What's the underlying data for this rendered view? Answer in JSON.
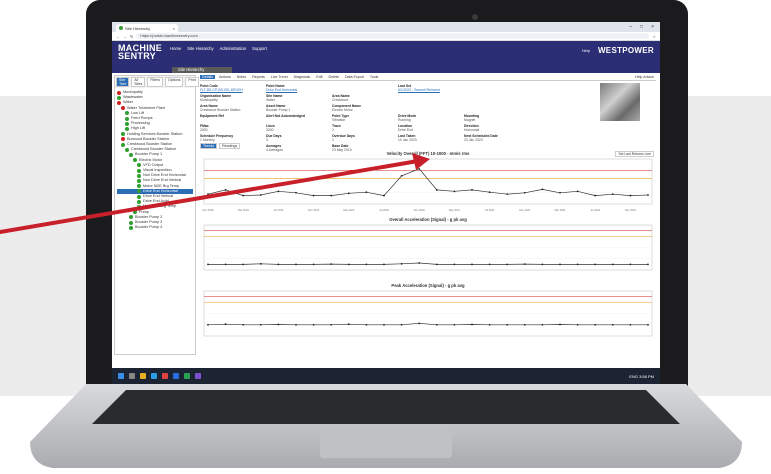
{
  "browser": {
    "tab_title": "Site Hierarchy",
    "url": "https://portal.machinesentry.com",
    "window_controls": [
      "–",
      "□",
      "×"
    ]
  },
  "app": {
    "logo_line1": "MACHINE",
    "logo_line2": "SENTRY",
    "nav": [
      "Home",
      "Site Hierarchy",
      "Administration",
      "Support"
    ],
    "help": "Help",
    "brand": "WESTPOWER",
    "page_title": "Site Hierarchy"
  },
  "sidebar": {
    "tabs": [
      "Site Tree",
      "All Sites",
      "Filters",
      "Options",
      "Print"
    ],
    "tree": [
      {
        "label": "Municipality",
        "status": "red",
        "depth": 0
      },
      {
        "label": "Wastewater",
        "status": "green",
        "depth": 0
      },
      {
        "label": "Water",
        "status": "red",
        "depth": 0
      },
      {
        "label": "Water Treatment Plant",
        "status": "red",
        "depth": 1
      },
      {
        "label": "Low Lift",
        "status": "green",
        "depth": 2
      },
      {
        "label": "Feed Pumps",
        "status": "green",
        "depth": 2
      },
      {
        "label": "Processing",
        "status": "green",
        "depth": 2
      },
      {
        "label": "High Lift",
        "status": "green",
        "depth": 2
      },
      {
        "label": "Holding Services Booster Station",
        "status": "green",
        "depth": 1
      },
      {
        "label": "Burwood Booster Station",
        "status": "red",
        "depth": 1
      },
      {
        "label": "Crestwood Booster Station",
        "status": "green",
        "depth": 1
      },
      {
        "label": "Crestwood Booster Station",
        "status": "green",
        "depth": 2
      },
      {
        "label": "Booster Pump 1",
        "status": "green",
        "depth": 3
      },
      {
        "label": "Electric Motor",
        "status": "green",
        "depth": 4
      },
      {
        "label": "VFD Output",
        "status": "green",
        "depth": 5
      },
      {
        "label": "Visual Inspection",
        "status": "green",
        "depth": 5
      },
      {
        "label": "Non Drive End Horizontal",
        "status": "green",
        "depth": 5
      },
      {
        "label": "Non Drive End Vertical",
        "status": "green",
        "depth": 5
      },
      {
        "label": "Motor NDE Brg Temp",
        "status": "green",
        "depth": 5
      },
      {
        "label": "Drive End Horizontal",
        "status": "green",
        "depth": 5,
        "selected": true
      },
      {
        "label": "Drive End Vertical",
        "status": "green",
        "depth": 5
      },
      {
        "label": "Drive End Axial",
        "status": "green",
        "depth": 5
      },
      {
        "label": "Motor DE Brg Temp",
        "status": "green",
        "depth": 5
      },
      {
        "label": "Pump",
        "status": "green",
        "depth": 4
      },
      {
        "label": "Booster Pump 2",
        "status": "green",
        "depth": 3
      },
      {
        "label": "Booster Pump 3",
        "status": "green",
        "depth": 3
      },
      {
        "label": "Booster Pump 4",
        "status": "green",
        "depth": 3
      }
    ]
  },
  "main": {
    "tabs": [
      "Details",
      "Actions",
      "Notes",
      "Reports",
      "Live Trend",
      "Diagnostic",
      "Edit",
      "Delete",
      "Data Export",
      "Tools"
    ],
    "help_label": "Help Advice",
    "fields": [
      {
        "k": "Point Code",
        "v": "FLT-DE-CP-BS-001-DEHZH",
        "link": true
      },
      {
        "k": "Point Name",
        "v": "Drive End Horizontal",
        "link": true
      },
      {
        "k": "",
        "v": ""
      },
      {
        "k": "Last Set",
        "v": "6/1/2022 - Summit Reinvest",
        "link": true
      },
      {
        "k": "",
        "v": ""
      },
      {
        "k": "Organisation Name",
        "v": "Municipality"
      },
      {
        "k": "Site Name",
        "v": "Water"
      },
      {
        "k": "Area Name",
        "v": "Crestwood"
      },
      {
        "k": "",
        "v": ""
      },
      {
        "k": "",
        "v": ""
      },
      {
        "k": "Area Name",
        "v": "Crestwood Booster Station"
      },
      {
        "k": "Asset Name",
        "v": "Booster Pump 1"
      },
      {
        "k": "Component Name",
        "v": "Electric Motor"
      },
      {
        "k": "",
        "v": ""
      },
      {
        "k": "",
        "v": ""
      },
      {
        "k": "Equipment Ref",
        "v": ""
      },
      {
        "k": "Alert Not Acknowledged",
        "v": ""
      },
      {
        "k": "Point Type",
        "v": "Vibration"
      },
      {
        "k": "Drive Mode",
        "v": "Running"
      },
      {
        "k": "Mounting",
        "v": "Magnet"
      },
      {
        "k": "FMax",
        "v": "2000"
      },
      {
        "k": "Lines",
        "v": "3200"
      },
      {
        "k": "Trace",
        "v": "2"
      },
      {
        "k": "Location",
        "v": "Drive End"
      },
      {
        "k": "Direction",
        "v": "Horizontal"
      },
      {
        "k": "Schedule Frequency",
        "v": "1 Monthly"
      },
      {
        "k": "Due Days",
        "v": "3"
      },
      {
        "k": "Overdue Days",
        "v": "1"
      },
      {
        "k": "Last Taken",
        "v": "10 Jan 2023"
      },
      {
        "k": "Next Scheduled Date",
        "v": "23 Jan 2023"
      },
      {
        "k": "Notes",
        "v": ""
      }
    ],
    "extra_field": {
      "k": "Averages",
      "v": "4 Averages"
    },
    "base_date": {
      "k": "Base Date",
      "v": "23 May 2019"
    },
    "subtabs": [
      "Trends",
      "Readings"
    ]
  },
  "charts": [
    {
      "title": "Velocity Overall (FFT) 10-1000 - mm/s rms",
      "button": "Set Last Returns Line"
    },
    {
      "title": "Overall Acceleration (Signal) - g pk avg",
      "button": ""
    },
    {
      "title": "Peak Acceleration (Signal) - g pk avg",
      "button": ""
    }
  ],
  "chart_data": [
    {
      "type": "line",
      "title": "Velocity Overall (FFT) 10-1000 - mm/s rms",
      "x": [
        "Nov 2018",
        "Jan 2019",
        "Mar 2019",
        "May 2019",
        "Jul 2019",
        "Sep 2019",
        "Nov 2019",
        "Jan 2020",
        "Mar 2020",
        "May 2020",
        "Jul 2020",
        "Sep 2020",
        "Nov 2020",
        "Jan 2021",
        "Mar 2021",
        "May 2021",
        "Jul 2021",
        "Sep 2021",
        "Nov 2021",
        "Jan 2022",
        "Mar 2022",
        "May 2022",
        "Jul 2022",
        "Sep 2022",
        "Nov 2022",
        "Jan 2023"
      ],
      "series": [
        {
          "values": [
            0.35,
            0.5,
            0.3,
            0.32,
            0.45,
            0.4,
            0.3,
            0.3,
            0.38,
            0.42,
            0.3,
            1.0,
            1.25,
            0.5,
            0.45,
            0.5,
            0.42,
            0.35,
            0.4,
            0.52,
            0.4,
            0.45,
            0.3,
            0.35,
            0.3,
            0.32
          ]
        }
      ],
      "thresholds": [
        {
          "value": 1.2,
          "color": "#d02020"
        },
        {
          "value": 0.9,
          "color": "#e8a020"
        }
      ],
      "ylim": [
        0,
        1.6
      ]
    },
    {
      "type": "line",
      "title": "Overall Acceleration (Signal) - g pk avg",
      "series": [
        {
          "values": [
            0.2,
            0.2,
            0.2,
            0.22,
            0.2,
            0.2,
            0.2,
            0.21,
            0.2,
            0.2,
            0.2,
            0.22,
            0.25,
            0.2,
            0.2,
            0.2,
            0.2,
            0.2,
            0.21,
            0.2,
            0.2,
            0.2,
            0.2,
            0.2,
            0.2,
            0.2
          ]
        }
      ],
      "thresholds": [
        {
          "value": 1.4,
          "color": "#d02020"
        },
        {
          "value": 1.2,
          "color": "#e8a020"
        }
      ],
      "ylim": [
        0,
        1.6
      ]
    },
    {
      "type": "line",
      "title": "Peak Acceleration (Signal) - g pk avg",
      "series": [
        {
          "values": [
            0.4,
            0.42,
            0.4,
            0.4,
            0.41,
            0.4,
            0.4,
            0.4,
            0.42,
            0.4,
            0.4,
            0.4,
            0.45,
            0.4,
            0.4,
            0.41,
            0.4,
            0.4,
            0.4,
            0.4,
            0.41,
            0.4,
            0.4,
            0.4,
            0.4,
            0.4
          ]
        }
      ],
      "thresholds": [
        {
          "value": 1.4,
          "color": "#d02020"
        },
        {
          "value": 1.2,
          "color": "#e8a020"
        }
      ],
      "ylim": [
        0,
        1.6
      ]
    }
  ],
  "taskbar": {
    "clock": "3:58 PM",
    "lang": "ENG"
  }
}
